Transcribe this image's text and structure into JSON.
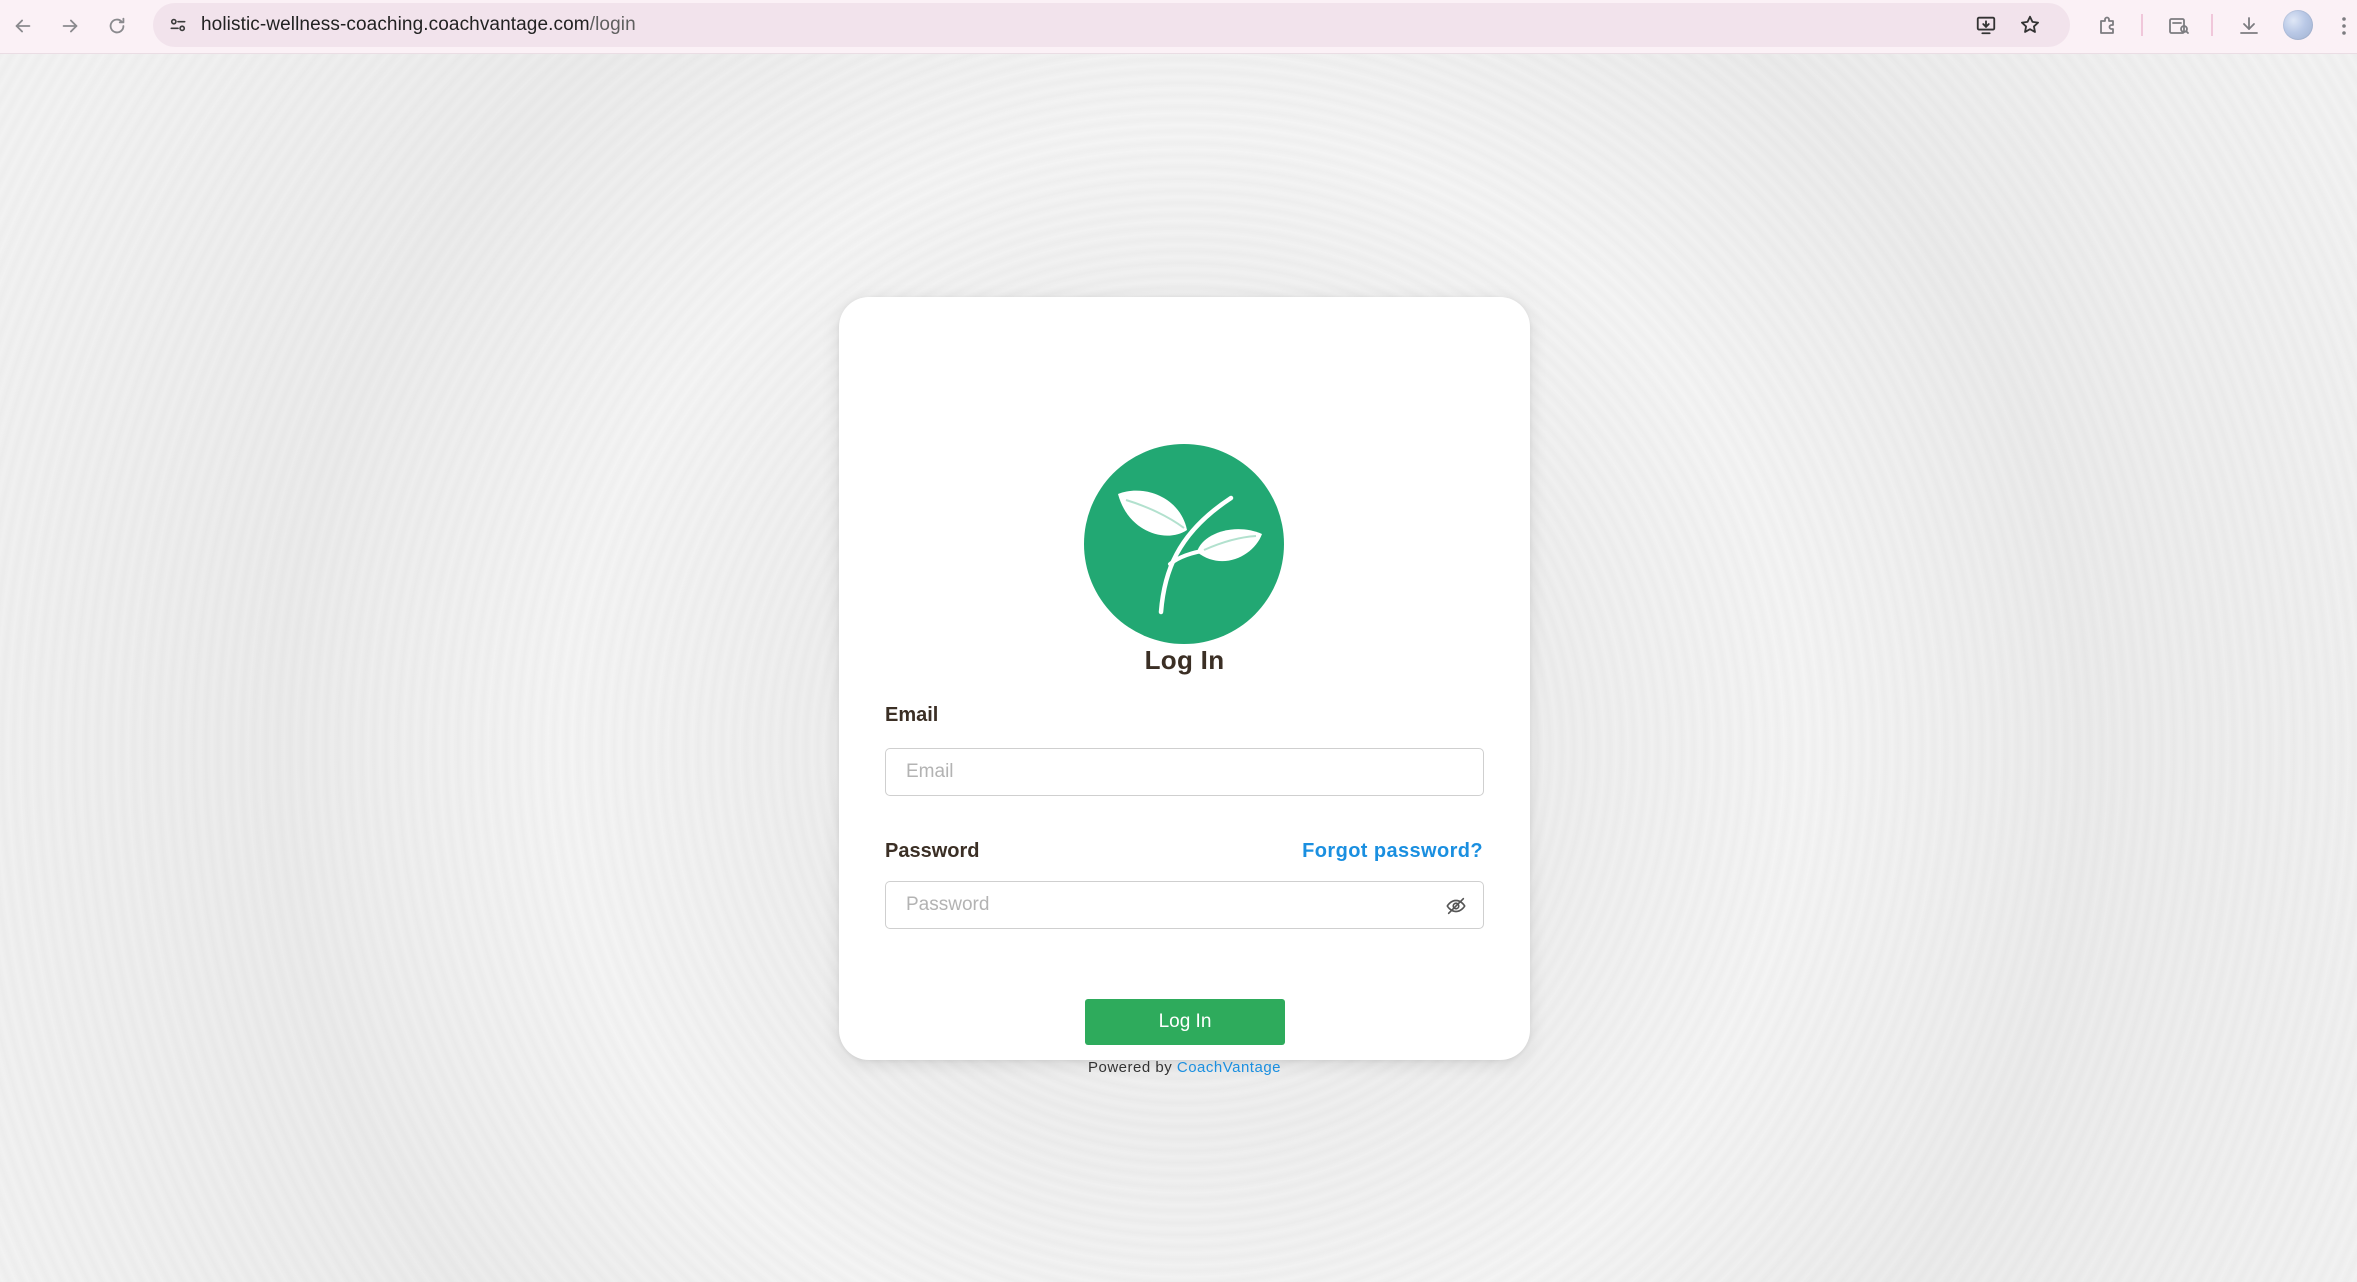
{
  "browser": {
    "url_host": "holistic-wellness-coaching.coachvantage.com",
    "url_path": "/login",
    "icons": {
      "back": "back-arrow-icon",
      "forward": "forward-arrow-icon",
      "reload": "reload-icon",
      "site_settings": "tune-icon",
      "install": "install-app-icon",
      "bookmark": "star-icon",
      "extensions": "puzzle-icon",
      "reading_mode": "reading-mode-icon",
      "downloads": "download-icon",
      "profile": "avatar",
      "menu": "kebab-menu-icon"
    }
  },
  "login": {
    "title": "Log In",
    "email_label": "Email",
    "email_placeholder": "Email",
    "password_label": "Password",
    "password_placeholder": "Password",
    "forgot_password": "Forgot password?",
    "submit_label": "Log In",
    "powered_by_prefix": "Powered by ",
    "powered_by_link": "CoachVantage"
  },
  "colors": {
    "brand_green": "#22a873",
    "button_green": "#2eab5c",
    "link_blue": "#1a8fe0",
    "label_brown": "#3b2f25"
  }
}
